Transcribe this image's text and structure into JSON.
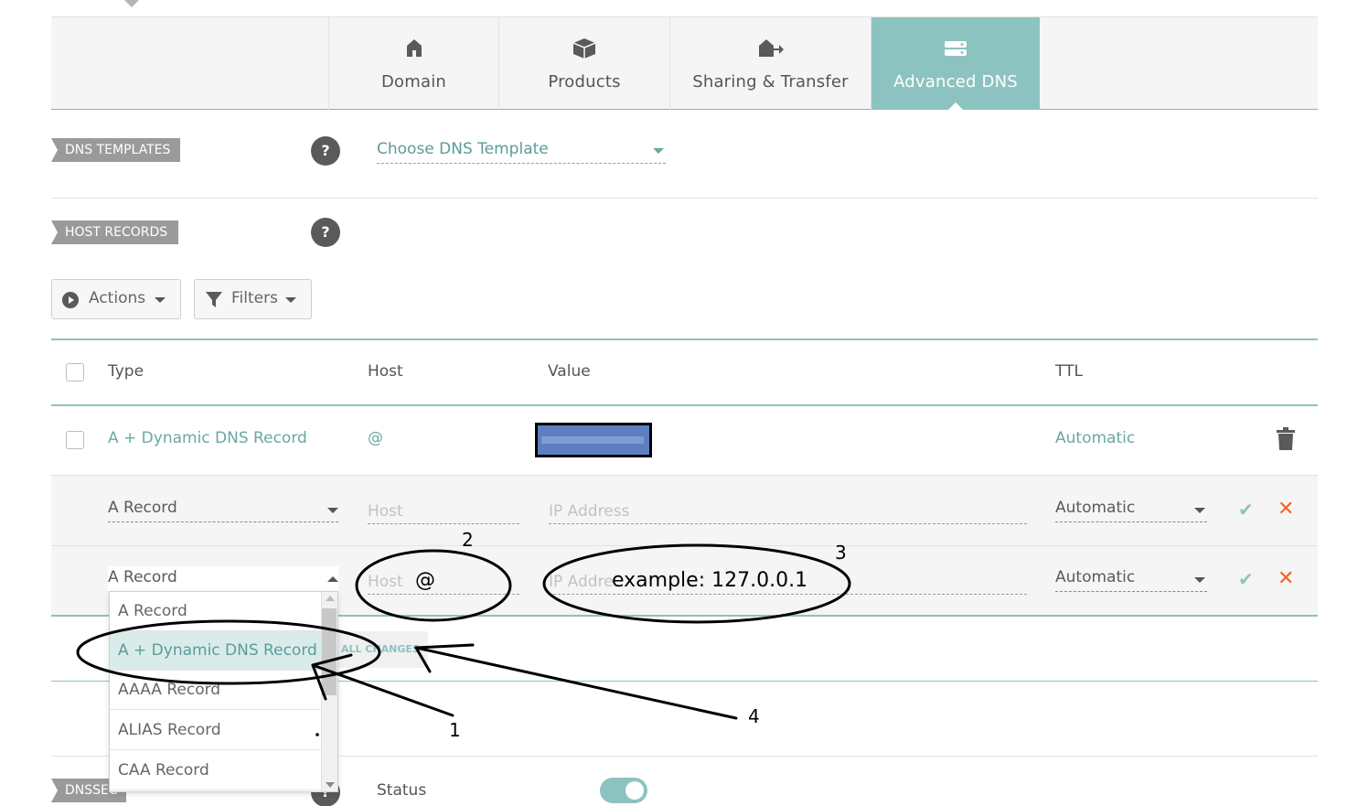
{
  "tabs": [
    {
      "label": "Domain",
      "icon": "home-icon"
    },
    {
      "label": "Products",
      "icon": "box-icon"
    },
    {
      "label": "Sharing & Transfer",
      "icon": "transfer-icon"
    },
    {
      "label": "Advanced DNS",
      "icon": "server-icon",
      "active": true
    }
  ],
  "dns_templates": {
    "tag": "DNS TEMPLATES",
    "help": "?",
    "select_placeholder": "Choose DNS Template"
  },
  "host_records": {
    "tag": "HOST RECORDS",
    "help": "?",
    "actions_label": "Actions",
    "filters_label": "Filters",
    "columns": {
      "type": "Type",
      "host": "Host",
      "value": "Value",
      "ttl": "TTL"
    },
    "existing_row": {
      "type": "A + Dynamic DNS Record",
      "host": "@",
      "ttl": "Automatic"
    },
    "new_row_1": {
      "type": "A Record",
      "host_placeholder": "Host",
      "value_placeholder": "IP Address",
      "ttl": "Automatic"
    },
    "new_row_2": {
      "type": "A Record",
      "host_placeholder": "Host",
      "value_placeholder": "IP Addre",
      "ttl": "Automatic"
    },
    "save_all_label": "ALL CHANGES"
  },
  "type_dropdown": {
    "options": [
      "A Record",
      "A + Dynamic DNS Record",
      "AAAA Record",
      "ALIAS Record",
      "CAA Record"
    ],
    "selected": "A + Dynamic DNS Record"
  },
  "dnssec": {
    "tag": "DNSSEC",
    "status_label": "Status",
    "status_on": true
  },
  "annotations": {
    "n1": "1",
    "n2": "2",
    "n3": "3",
    "n4": "4",
    "host_text": "@",
    "value_text": "example: 127.0.0.1"
  },
  "colors": {
    "accent": "#8cc3c0",
    "accent_text": "#6aa8a4",
    "cancel": "#f26522",
    "tag_bg": "#9a9a9a"
  }
}
